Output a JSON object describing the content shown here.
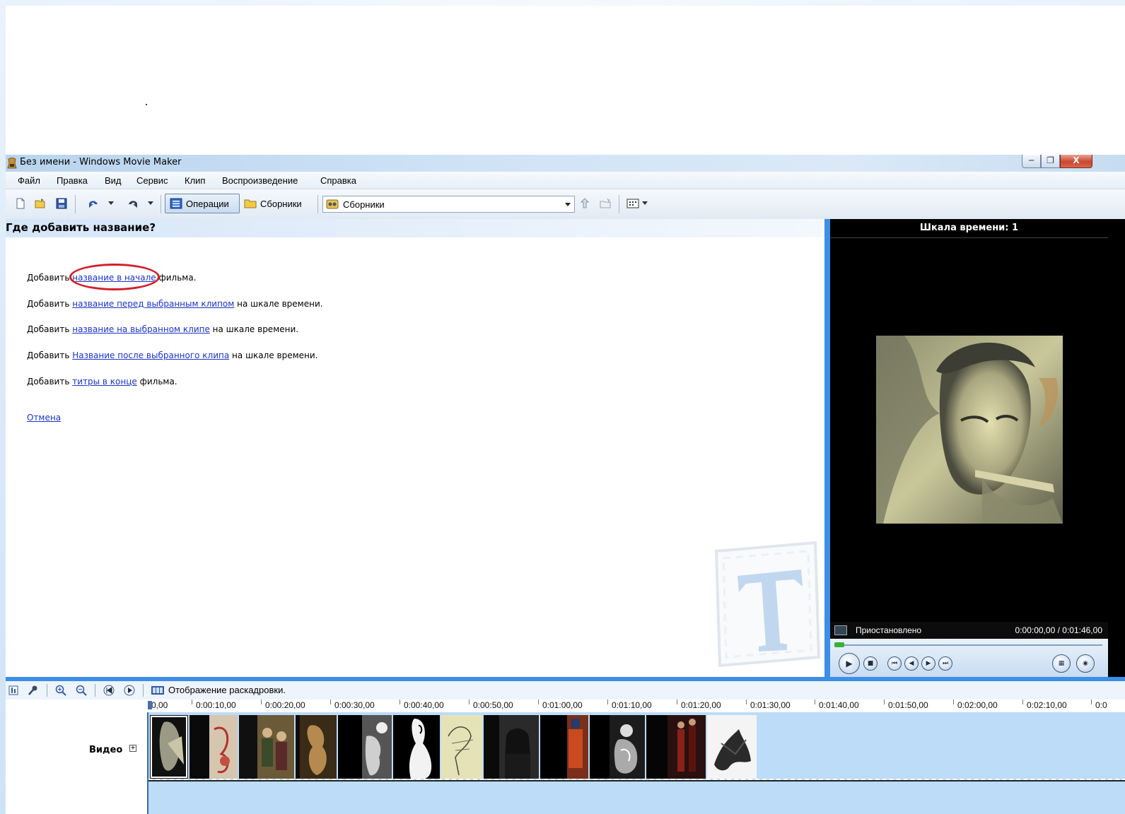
{
  "window": {
    "title": "Без имени - Windows Movie Maker",
    "controls": [
      "minimize",
      "maximize",
      "close"
    ],
    "close_glyph": "X"
  },
  "menu": [
    "Файл",
    "Правка",
    "Вид",
    "Сервис",
    "Клип",
    "Воспроизведение",
    "Справка"
  ],
  "toolbar": {
    "operations_label": "Операции",
    "collections_label": "Сборники",
    "collections_combo": "Сборники"
  },
  "task_pane": {
    "title": "Где добавить название?",
    "options": [
      {
        "prefix": "Добавить ",
        "link": "название в начале",
        "suffix": " фильма."
      },
      {
        "prefix": "Добавить ",
        "link": "название перед выбранным клипом",
        "suffix": " на шкале времени."
      },
      {
        "prefix": "Добавить ",
        "link": "название на выбранном клипе",
        "suffix": " на шкале времени."
      },
      {
        "prefix": "Добавить ",
        "link": "Название после выбранного клипа",
        "suffix": " на шкале времени."
      },
      {
        "prefix": "Добавить ",
        "link": "титры в конце",
        "suffix": " фильма."
      }
    ],
    "cancel_link": "Отмена",
    "highlighted_option": 0,
    "highlight_color": "#d2202a"
  },
  "preview": {
    "title": "Шкала времени: 1",
    "status": "Приостановлено",
    "time": "0:00:00,00 / 0:01:46,00",
    "seek_progress": 0
  },
  "timeline": {
    "view_label": "Отображение раскадровки.",
    "ruler_ticks": [
      "0,00",
      "0:00:10,00",
      "0:00:20,00",
      "0:00:30,00",
      "0:00:40,00",
      "0:00:50,00",
      "0:01:00,00",
      "0:01:10,00",
      "0:01:20,00",
      "0:01:30,00",
      "0:01:40,00",
      "0:01:50,00",
      "0:02:00,00",
      "0:02:10,00",
      "0:0"
    ],
    "video_track_label": "Видео",
    "expand_glyph": "+",
    "clip_count": 13
  },
  "colors": {
    "accent_blue": "#3d8ee6",
    "link": "#1a33cc",
    "track_bg": "#bcdcf7",
    "seek": "#3ab03a"
  }
}
